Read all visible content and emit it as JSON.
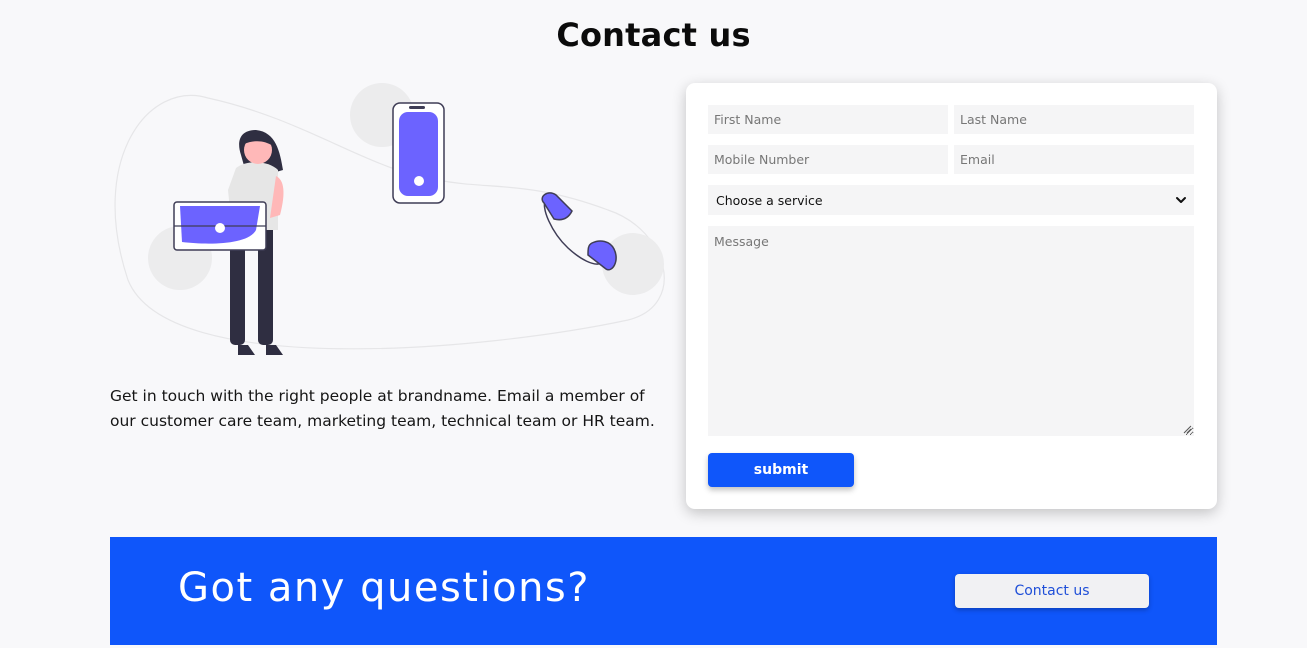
{
  "header": {
    "title": "Contact us"
  },
  "intro": {
    "text": "Get in touch with the right people at brandname. Email a member of our customer care team, marketing team, technical team or HR team."
  },
  "form": {
    "first_name": {
      "placeholder": "First Name",
      "value": ""
    },
    "last_name": {
      "placeholder": "Last Name",
      "value": ""
    },
    "mobile": {
      "placeholder": "Mobile Number",
      "value": ""
    },
    "email": {
      "placeholder": "Email",
      "value": ""
    },
    "service": {
      "selected": "Choose a service",
      "icon": "chevron-down-icon"
    },
    "message": {
      "placeholder": "Message",
      "value": ""
    },
    "submit_label": "submit"
  },
  "banner": {
    "text": "Got any questions?",
    "button_label": "Contact us"
  },
  "colors": {
    "accent": "#0f56fa",
    "illustration_purple": "#6c63ff",
    "background": "#f8f8fa"
  }
}
